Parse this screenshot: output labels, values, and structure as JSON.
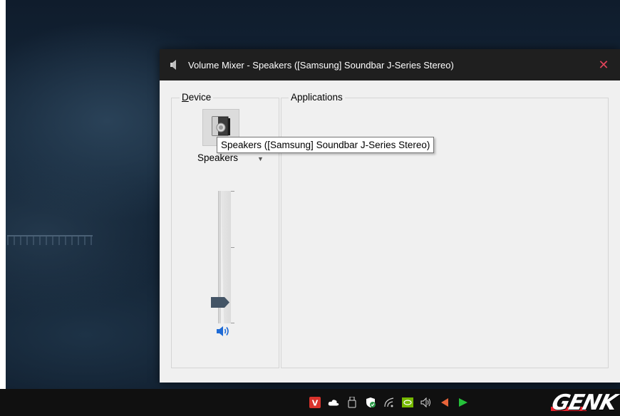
{
  "window": {
    "title": "Volume Mixer - Speakers ([Samsung] Soundbar J-Series Stereo)",
    "close_glyph": "✕"
  },
  "device_group": {
    "label_underlined_char": "D",
    "label_rest": "evice",
    "device_name": "Speakers",
    "tooltip": "Speakers ([Samsung] Soundbar J-Series Stereo)",
    "volume_level_fraction": 0.13,
    "icons": [
      "speaker-device-icon",
      "speaker-volume-icon",
      "chevron-down-icon"
    ]
  },
  "applications_group": {
    "label": "Applications"
  },
  "taskbar": {
    "tray_icons": [
      "vivaldi-icon",
      "onedrive-icon",
      "usb-drive-icon",
      "security-shield-icon",
      "wifi-icon",
      "nvidia-icon",
      "volume-icon",
      "notification-arrow-icon",
      "green-play-icon"
    ],
    "watermark": "GENK"
  },
  "colors": {
    "titlebar": "#1f1f1f",
    "close": "#e0435a",
    "accent_blue": "#1e6bd6",
    "window_bg": "#f0f0f0"
  }
}
